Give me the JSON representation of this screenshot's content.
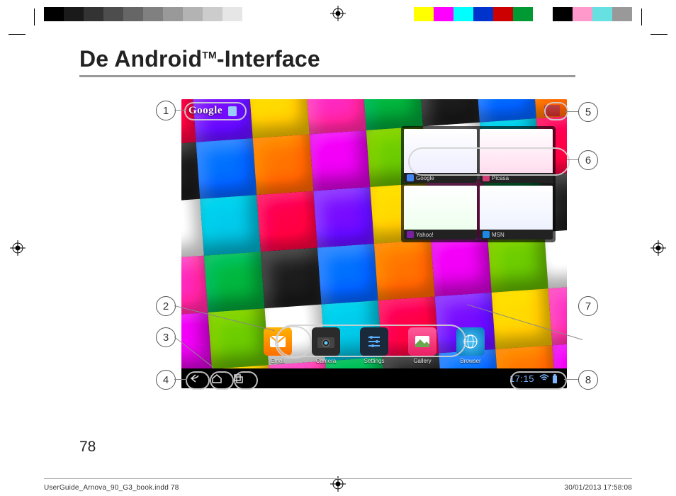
{
  "colorbars": {
    "left": [
      "#000000",
      "#1a1a1a",
      "#333333",
      "#4d4d4d",
      "#666666",
      "#808080",
      "#999999",
      "#b3b3b3",
      "#cccccc",
      "#e6e6e6",
      "#ffffff"
    ],
    "right": [
      "#ffff00",
      "#ff00ff",
      "#00ffff",
      "#0033cc",
      "#cc0000",
      "#009933",
      "#ffffff",
      "#000000",
      "#ff99cc",
      "#66e0e0",
      "#999999"
    ]
  },
  "title": {
    "text": "De Android",
    "tm": "TM",
    "suffix": "-Interface"
  },
  "callouts": [
    "1",
    "2",
    "3",
    "4",
    "5",
    "6",
    "7",
    "8"
  ],
  "screenshot": {
    "search_label": "Google",
    "widget_labels": [
      "Google",
      "Picasa",
      "Yahoo!",
      "MSN"
    ],
    "apps": [
      {
        "name": "Email"
      },
      {
        "name": "Camera"
      },
      {
        "name": "Settings"
      },
      {
        "name": "Gallery"
      },
      {
        "name": "Browser"
      }
    ],
    "clock": "17:15"
  },
  "page_number": "78",
  "footer": {
    "file": "UserGuide_Arnova_90_G3_book.indd   78",
    "datetime": "30/01/2013   17:58:08"
  }
}
